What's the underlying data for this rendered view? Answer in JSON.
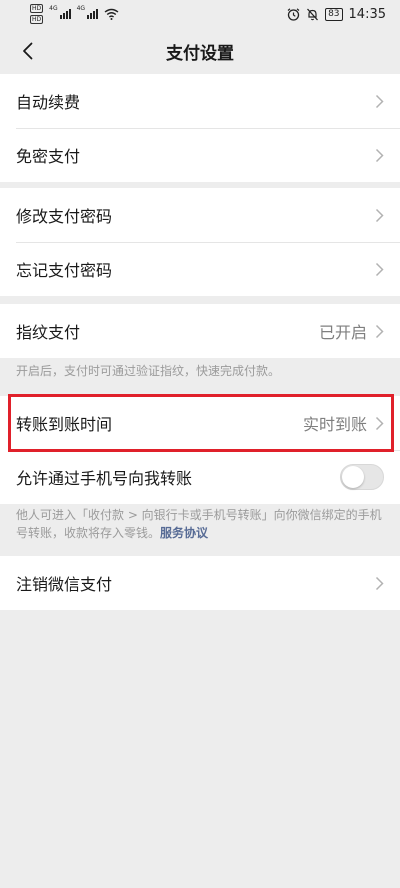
{
  "status_bar": {
    "sim1": "HD",
    "sim2": "HD",
    "net1": "4G",
    "net2": "4G",
    "battery": "83",
    "time": "14:35"
  },
  "nav": {
    "title": "支付设置"
  },
  "group1": [
    {
      "label": "自动续费"
    },
    {
      "label": "免密支付"
    }
  ],
  "group2": [
    {
      "label": "修改支付密码"
    },
    {
      "label": "忘记支付密码"
    }
  ],
  "fingerprint": {
    "label": "指纹支付",
    "value": "已开启",
    "hint": "开启后，支付时可通过验证指纹，快速完成付款。"
  },
  "transfer": {
    "arrival_label": "转账到账时间",
    "arrival_value": "实时到账",
    "phone_label": "允许通过手机号向我转账",
    "phone_enabled": false,
    "hint": "他人可进入「收付款 > 向银行卡或手机号转账」向你微信绑定的手机号转账，收款将存入零钱。",
    "hint_link": "服务协议"
  },
  "deregister": {
    "label": "注销微信支付"
  },
  "colors": {
    "background": "#ededed",
    "card": "#ffffff",
    "link": "#576b95",
    "highlight": "#e0202a"
  }
}
